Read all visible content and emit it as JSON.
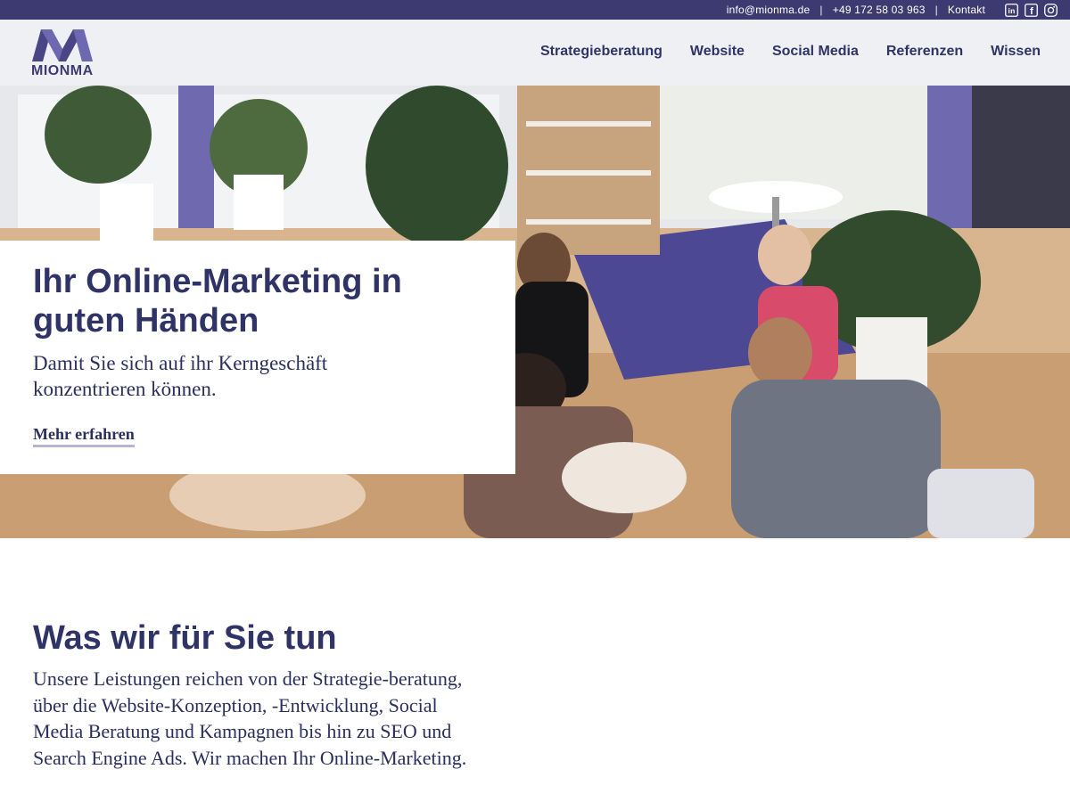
{
  "topbar": {
    "email": "info@mionma.de",
    "phone": "+49 172 58 03 963",
    "contact": "Kontakt",
    "separator": "|",
    "socials": [
      {
        "name": "linkedin-icon",
        "glyph": "in"
      },
      {
        "name": "facebook-icon",
        "glyph": "f"
      },
      {
        "name": "instagram-icon",
        "glyph": ""
      }
    ]
  },
  "header": {
    "logo_text": "MIONMA",
    "nav": [
      {
        "label": "Strategieberatung"
      },
      {
        "label": "Website"
      },
      {
        "label": "Social Media"
      },
      {
        "label": "Referenzen"
      },
      {
        "label": "Wissen"
      }
    ]
  },
  "hero": {
    "title": "Ihr Online-Marketing in guten Händen",
    "subtitle": "Damit Sie sich auf ihr Kerngeschäft konzentrieren können.",
    "cta": "Mehr erfahren"
  },
  "services": {
    "heading": "Was wir für Sie tun",
    "text": "Unsere Leistungen reichen von der Strategie-beratung, über die Website-Konzeption, -Entwicklung, Social Media Beratung und Kampagnen bis hin zu SEO und Search Engine Ads. Wir machen Ihr Online-Marketing."
  },
  "colors": {
    "brand": "#3d3a72",
    "text": "#2f3366",
    "accent_underline": "#b8b4d6",
    "header_bg": "#eef0f4"
  }
}
